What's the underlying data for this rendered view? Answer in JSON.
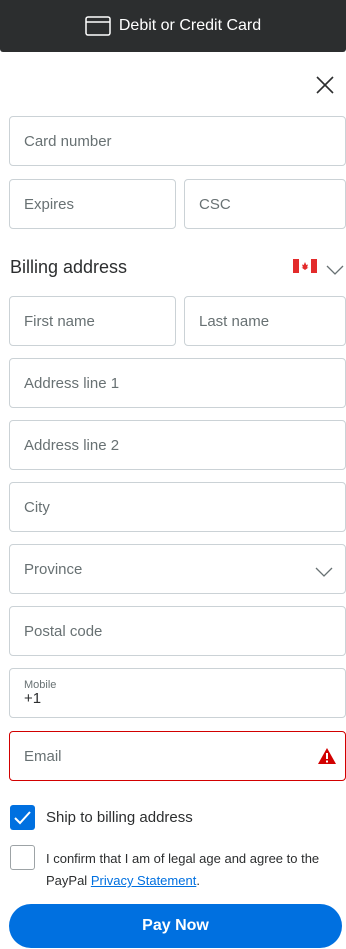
{
  "header": {
    "title": "Debit or Credit Card",
    "icon": "credit-card-icon"
  },
  "close": {
    "icon": "close-icon"
  },
  "card": {
    "number_placeholder": "Card number",
    "expires_placeholder": "Expires",
    "csc_placeholder": "CSC"
  },
  "billing": {
    "title": "Billing address",
    "country_flag": "canada-flag-icon",
    "first_name": "First name",
    "last_name": "Last name",
    "address1": "Address line 1",
    "address2": "Address line 2",
    "city": "City",
    "province": "Province",
    "postal": "Postal code",
    "mobile_label": "Mobile",
    "mobile_value": "+1",
    "email": "Email"
  },
  "options": {
    "ship_label": "Ship to billing address",
    "ship_checked": true,
    "confirm_text": "I confirm that I am of legal age and agree to the PayPal",
    "confirm_link": "Privacy Statement",
    "confirm_end": ".",
    "confirm_checked": false
  },
  "pay_button": "Pay Now",
  "colors": {
    "accent": "#0070e0",
    "error": "#d20000",
    "header_bg": "#2c2e2f"
  }
}
